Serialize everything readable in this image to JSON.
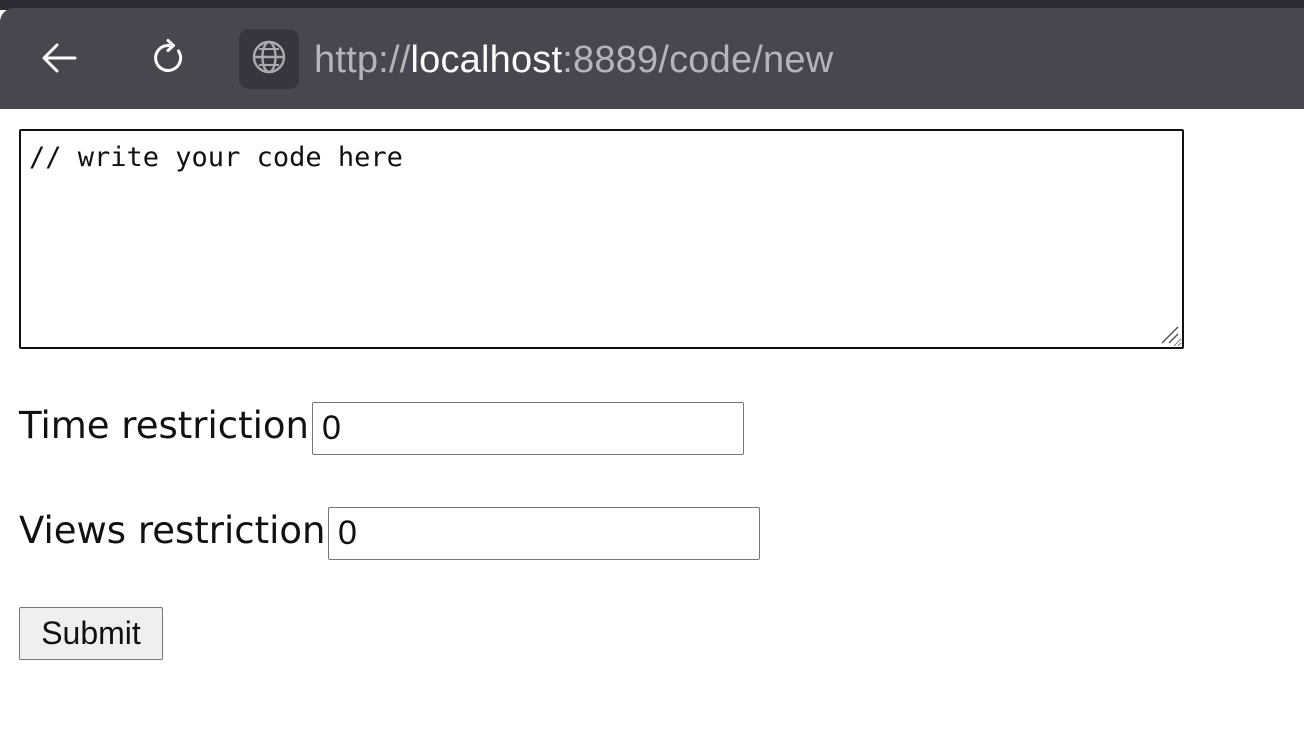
{
  "browser": {
    "url": {
      "scheme": "http://",
      "host": "localhost",
      "rest": ":8889/code/new"
    },
    "icons": {
      "back": "arrow-left-icon",
      "reload": "reload-icon",
      "site": "globe-icon"
    },
    "colors": {
      "bar": "#46474f",
      "strip": "#2b2c33"
    }
  },
  "form": {
    "code": {
      "value": "// write your code here"
    },
    "time_restriction": {
      "label": "Time restriction:",
      "value": "0"
    },
    "views_restriction": {
      "label": "Views restriction:",
      "value": "0"
    },
    "submit_label": "Submit"
  }
}
